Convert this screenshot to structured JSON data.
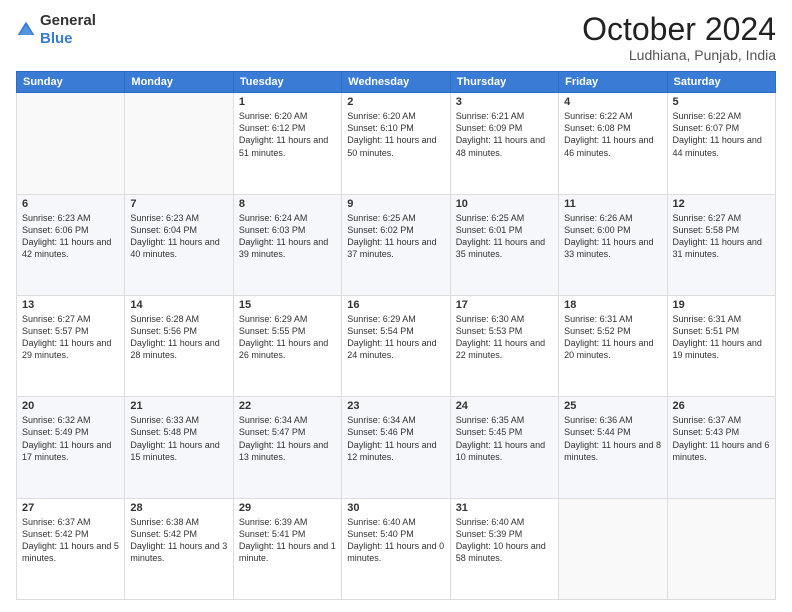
{
  "logo": {
    "general": "General",
    "blue": "Blue"
  },
  "header": {
    "month": "October 2024",
    "location": "Ludhiana, Punjab, India"
  },
  "weekdays": [
    "Sunday",
    "Monday",
    "Tuesday",
    "Wednesday",
    "Thursday",
    "Friday",
    "Saturday"
  ],
  "weeks": [
    [
      {
        "day": "",
        "sunrise": "",
        "sunset": "",
        "daylight": ""
      },
      {
        "day": "",
        "sunrise": "",
        "sunset": "",
        "daylight": ""
      },
      {
        "day": "1",
        "sunrise": "Sunrise: 6:20 AM",
        "sunset": "Sunset: 6:12 PM",
        "daylight": "Daylight: 11 hours and 51 minutes."
      },
      {
        "day": "2",
        "sunrise": "Sunrise: 6:20 AM",
        "sunset": "Sunset: 6:10 PM",
        "daylight": "Daylight: 11 hours and 50 minutes."
      },
      {
        "day": "3",
        "sunrise": "Sunrise: 6:21 AM",
        "sunset": "Sunset: 6:09 PM",
        "daylight": "Daylight: 11 hours and 48 minutes."
      },
      {
        "day": "4",
        "sunrise": "Sunrise: 6:22 AM",
        "sunset": "Sunset: 6:08 PM",
        "daylight": "Daylight: 11 hours and 46 minutes."
      },
      {
        "day": "5",
        "sunrise": "Sunrise: 6:22 AM",
        "sunset": "Sunset: 6:07 PM",
        "daylight": "Daylight: 11 hours and 44 minutes."
      }
    ],
    [
      {
        "day": "6",
        "sunrise": "Sunrise: 6:23 AM",
        "sunset": "Sunset: 6:06 PM",
        "daylight": "Daylight: 11 hours and 42 minutes."
      },
      {
        "day": "7",
        "sunrise": "Sunrise: 6:23 AM",
        "sunset": "Sunset: 6:04 PM",
        "daylight": "Daylight: 11 hours and 40 minutes."
      },
      {
        "day": "8",
        "sunrise": "Sunrise: 6:24 AM",
        "sunset": "Sunset: 6:03 PM",
        "daylight": "Daylight: 11 hours and 39 minutes."
      },
      {
        "day": "9",
        "sunrise": "Sunrise: 6:25 AM",
        "sunset": "Sunset: 6:02 PM",
        "daylight": "Daylight: 11 hours and 37 minutes."
      },
      {
        "day": "10",
        "sunrise": "Sunrise: 6:25 AM",
        "sunset": "Sunset: 6:01 PM",
        "daylight": "Daylight: 11 hours and 35 minutes."
      },
      {
        "day": "11",
        "sunrise": "Sunrise: 6:26 AM",
        "sunset": "Sunset: 6:00 PM",
        "daylight": "Daylight: 11 hours and 33 minutes."
      },
      {
        "day": "12",
        "sunrise": "Sunrise: 6:27 AM",
        "sunset": "Sunset: 5:58 PM",
        "daylight": "Daylight: 11 hours and 31 minutes."
      }
    ],
    [
      {
        "day": "13",
        "sunrise": "Sunrise: 6:27 AM",
        "sunset": "Sunset: 5:57 PM",
        "daylight": "Daylight: 11 hours and 29 minutes."
      },
      {
        "day": "14",
        "sunrise": "Sunrise: 6:28 AM",
        "sunset": "Sunset: 5:56 PM",
        "daylight": "Daylight: 11 hours and 28 minutes."
      },
      {
        "day": "15",
        "sunrise": "Sunrise: 6:29 AM",
        "sunset": "Sunset: 5:55 PM",
        "daylight": "Daylight: 11 hours and 26 minutes."
      },
      {
        "day": "16",
        "sunrise": "Sunrise: 6:29 AM",
        "sunset": "Sunset: 5:54 PM",
        "daylight": "Daylight: 11 hours and 24 minutes."
      },
      {
        "day": "17",
        "sunrise": "Sunrise: 6:30 AM",
        "sunset": "Sunset: 5:53 PM",
        "daylight": "Daylight: 11 hours and 22 minutes."
      },
      {
        "day": "18",
        "sunrise": "Sunrise: 6:31 AM",
        "sunset": "Sunset: 5:52 PM",
        "daylight": "Daylight: 11 hours and 20 minutes."
      },
      {
        "day": "19",
        "sunrise": "Sunrise: 6:31 AM",
        "sunset": "Sunset: 5:51 PM",
        "daylight": "Daylight: 11 hours and 19 minutes."
      }
    ],
    [
      {
        "day": "20",
        "sunrise": "Sunrise: 6:32 AM",
        "sunset": "Sunset: 5:49 PM",
        "daylight": "Daylight: 11 hours and 17 minutes."
      },
      {
        "day": "21",
        "sunrise": "Sunrise: 6:33 AM",
        "sunset": "Sunset: 5:48 PM",
        "daylight": "Daylight: 11 hours and 15 minutes."
      },
      {
        "day": "22",
        "sunrise": "Sunrise: 6:34 AM",
        "sunset": "Sunset: 5:47 PM",
        "daylight": "Daylight: 11 hours and 13 minutes."
      },
      {
        "day": "23",
        "sunrise": "Sunrise: 6:34 AM",
        "sunset": "Sunset: 5:46 PM",
        "daylight": "Daylight: 11 hours and 12 minutes."
      },
      {
        "day": "24",
        "sunrise": "Sunrise: 6:35 AM",
        "sunset": "Sunset: 5:45 PM",
        "daylight": "Daylight: 11 hours and 10 minutes."
      },
      {
        "day": "25",
        "sunrise": "Sunrise: 6:36 AM",
        "sunset": "Sunset: 5:44 PM",
        "daylight": "Daylight: 11 hours and 8 minutes."
      },
      {
        "day": "26",
        "sunrise": "Sunrise: 6:37 AM",
        "sunset": "Sunset: 5:43 PM",
        "daylight": "Daylight: 11 hours and 6 minutes."
      }
    ],
    [
      {
        "day": "27",
        "sunrise": "Sunrise: 6:37 AM",
        "sunset": "Sunset: 5:42 PM",
        "daylight": "Daylight: 11 hours and 5 minutes."
      },
      {
        "day": "28",
        "sunrise": "Sunrise: 6:38 AM",
        "sunset": "Sunset: 5:42 PM",
        "daylight": "Daylight: 11 hours and 3 minutes."
      },
      {
        "day": "29",
        "sunrise": "Sunrise: 6:39 AM",
        "sunset": "Sunset: 5:41 PM",
        "daylight": "Daylight: 11 hours and 1 minute."
      },
      {
        "day": "30",
        "sunrise": "Sunrise: 6:40 AM",
        "sunset": "Sunset: 5:40 PM",
        "daylight": "Daylight: 11 hours and 0 minutes."
      },
      {
        "day": "31",
        "sunrise": "Sunrise: 6:40 AM",
        "sunset": "Sunset: 5:39 PM",
        "daylight": "Daylight: 10 hours and 58 minutes."
      },
      {
        "day": "",
        "sunrise": "",
        "sunset": "",
        "daylight": ""
      },
      {
        "day": "",
        "sunrise": "",
        "sunset": "",
        "daylight": ""
      }
    ]
  ]
}
